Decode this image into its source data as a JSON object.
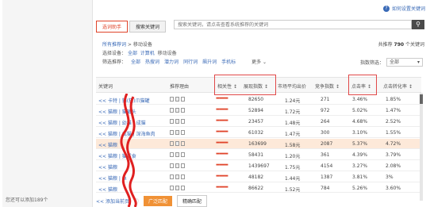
{
  "help": {
    "icon": "question-circle-icon",
    "label": "如何设置关键词"
  },
  "left_panel": {
    "hint": "您还可以添加189个"
  },
  "tabs": [
    {
      "label": "选词助手",
      "active": true
    },
    {
      "label": "搜索关键词",
      "active": false
    }
  ],
  "search": {
    "placeholder": "搜索关键词，请点击查看系统推荐的关键词",
    "button_icon": "search-icon"
  },
  "breadcrumb": {
    "all": "所有推荐词",
    "sep": " > ",
    "current": "移动设备"
  },
  "device_row": {
    "label": "选择设备：",
    "opt_all": "全部",
    "opt_pc": "计算机",
    "opt_mobile": "移动设备"
  },
  "total": {
    "prefix": "共推荐",
    "count": "790",
    "suffix": "个关键词"
  },
  "filter_row": {
    "label": "筛选推荐：",
    "items": [
      "全部",
      "热搜词",
      "潜力词",
      "同行词",
      "飙升词",
      "手机标"
    ],
    "more": "更多"
  },
  "sort": {
    "label": "指数筛选：",
    "value": "全部"
  },
  "table": {
    "headers": [
      "关键词",
      "推荐理由",
      "相关性",
      "展现指数",
      "市场平均出价",
      "竞争指数",
      "点击率",
      "点击转化率"
    ],
    "rows": [
      {
        "keyword": "<< 卡特 | 猫(猫)爪猫罐",
        "stars": "▬▬▬▬",
        "impressions": "82650",
        "avg_bid": "1.24元",
        "competition": "271",
        "ctr": "3.46%",
        "cvr": "1.85%",
        "highlight": false
      },
      {
        "keyword": "<< 猫粮 | 猫罐头",
        "stars": "▬▬▬▬",
        "impressions": "52894",
        "avg_bid": "1.72元",
        "competition": "972",
        "ctr": "5.02%",
        "cvr": "1.47%",
        "highlight": false
      },
      {
        "keyword": "<< 猫粮 | 幼猫 | 成猫",
        "stars": "▬▬▬▬",
        "impressions": "23457",
        "avg_bid": "1.48元",
        "competition": "264",
        "ctr": "4.68%",
        "cvr": "2.52%",
        "highlight": false
      },
      {
        "keyword": "<< 猫粮 | 成猫 | 深海鱼肉",
        "stars": "▬▬▬▬",
        "impressions": "61032",
        "avg_bid": "1.47元",
        "competition": "300",
        "ctr": "3.10%",
        "cvr": "1.55%",
        "highlight": false
      },
      {
        "keyword": "<< 猫粮",
        "stars": "▬▬▬▬",
        "impressions": "163699",
        "avg_bid": "1.58元",
        "competition": "2087",
        "ctr": "5.37%",
        "cvr": "4.72%",
        "highlight": true
      },
      {
        "keyword": "<< 猫粮 | 猫零食",
        "stars": "▬▬▬▬",
        "impressions": "58431",
        "avg_bid": "1.20元",
        "competition": "361",
        "ctr": "4.39%",
        "cvr": "3.79%",
        "highlight": false
      },
      {
        "keyword": "<< 猫粮",
        "stars": "▬▬▬▬",
        "impressions": "1439697",
        "avg_bid": "1.75元",
        "competition": "4154",
        "ctr": "3.27%",
        "cvr": "2.08%",
        "highlight": false
      },
      {
        "keyword": "<< 猫粮 | 鱼",
        "stars": "▬▬▬▬",
        "impressions": "48182",
        "avg_bid": "1.44元",
        "competition": "1387",
        "ctr": "3.81%",
        "cvr": "3%",
        "highlight": false
      },
      {
        "keyword": "<< 猫粮",
        "stars": "▬▬▬▬",
        "impressions": "86622",
        "avg_bid": "1.52元",
        "competition": "784",
        "ctr": "5.26%",
        "cvr": "3.60%",
        "highlight": false
      }
    ]
  },
  "bottom": {
    "add_page": "<< 添加当前页",
    "broad_match": "广泛匹配",
    "exact_match": "精确匹配"
  }
}
